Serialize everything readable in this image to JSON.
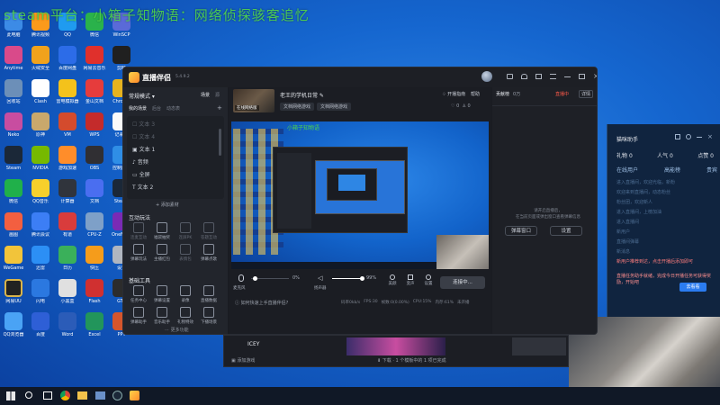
{
  "overlay": {
    "title": "steam平台：小箱子知物语：网络侦探骇客追忆"
  },
  "desktop_icons": [
    {
      "label": "此电脑",
      "color": "#3c8be6"
    },
    {
      "label": "腾讯视频",
      "color": "#fb9a1b"
    },
    {
      "label": "QQ",
      "color": "#1f9bf0"
    },
    {
      "label": "微信",
      "color": "#2ab24b"
    },
    {
      "label": "WinSCP",
      "color": "#5a6ad8"
    },
    {
      "label": "Anytime",
      "color": "#d94a8a"
    },
    {
      "label": "火绒安全",
      "color": "#f1a21c"
    },
    {
      "label": "百度网盘",
      "color": "#2c6ce8"
    },
    {
      "label": "网易云音乐",
      "color": "#e0302c"
    },
    {
      "label": "剪映",
      "color": "#202020"
    },
    {
      "label": "回收站",
      "color": "#6c8fb8"
    },
    {
      "label": "Clash",
      "color": "#ffffff"
    },
    {
      "label": "雷电模拟器",
      "color": "#f4c21b"
    },
    {
      "label": "金山文档",
      "color": "#e63c3c"
    },
    {
      "label": "Chrome",
      "color": "#e6b31f"
    },
    {
      "label": "Neko",
      "color": "#c84da0"
    },
    {
      "label": "原神",
      "color": "#c9a86c"
    },
    {
      "label": "VM",
      "color": "#d44b2d"
    },
    {
      "label": "WPS",
      "color": "#c42b2b"
    },
    {
      "label": "记事本",
      "color": "#fafafa"
    },
    {
      "label": "Steam",
      "color": "#1b2838"
    },
    {
      "label": "NVIDIA",
      "color": "#76b900"
    },
    {
      "label": "游戏加速",
      "color": "#ff8d2a"
    },
    {
      "label": "OBS",
      "color": "#302f33"
    },
    {
      "label": "控制面板",
      "color": "#2f8ee6"
    },
    {
      "label": "微信",
      "color": "#20b04a"
    },
    {
      "label": "QQ音乐",
      "color": "#f7d02b"
    },
    {
      "label": "计算器",
      "color": "#30343c"
    },
    {
      "label": "文档",
      "color": "#4a6ef0"
    },
    {
      "label": "Steam",
      "color": "#1b2838"
    },
    {
      "label": "画图",
      "color": "#f35f40"
    },
    {
      "label": "腾讯会议",
      "color": "#3c7ef5"
    },
    {
      "label": "有道",
      "color": "#d93c3c"
    },
    {
      "label": "CPU-Z",
      "color": "#7ea0c8"
    },
    {
      "label": "OneNote",
      "color": "#7a2ab5"
    },
    {
      "label": "WeGame",
      "color": "#f2c43a"
    },
    {
      "label": "迅雷",
      "color": "#2c8ff5"
    },
    {
      "label": "日历",
      "color": "#3ab05a"
    },
    {
      "label": "快压",
      "color": "#f59c1b"
    },
    {
      "label": "设置",
      "color": "#b0b6c0"
    },
    {
      "label": "网易UU",
      "color": "#222",
      "gold": true
    },
    {
      "label": "闪电",
      "color": "#2b78e0"
    },
    {
      "label": "小黑盒",
      "color": "#e0e0e0"
    },
    {
      "label": "Flash",
      "color": "#d03030"
    },
    {
      "label": "GTA",
      "color": "#2c2c2c"
    },
    {
      "label": "QQ浏览器",
      "color": "#4aa3f5"
    },
    {
      "label": "百度",
      "color": "#2e5fd6"
    },
    {
      "label": "Word",
      "color": "#2b5cb8"
    },
    {
      "label": "Excel",
      "color": "#22955b"
    },
    {
      "label": "PPT",
      "color": "#d5552c"
    }
  ],
  "app": {
    "logo": "直播伴侣",
    "version": "5.4.9.2",
    "streamer_name": "老王的学机日常",
    "thumb_label": "在线网络版",
    "tags": [
      "文档网络游戏",
      "文档网络游戏"
    ],
    "topbar": {
      "notice": "开播指南",
      "help": "帮助",
      "rank_label": "贡献榜",
      "rank_value": "0万",
      "live_label": "直播中",
      "extra": "详情"
    },
    "metrics": {
      "likes": "0",
      "viewers": "0"
    },
    "sidebar": {
      "mode_label": "常规模式",
      "tab_scenes": "场景",
      "tab_sources": "源",
      "sub_tabs": [
        "我的场景",
        "后台",
        "动态表"
      ],
      "scene_items": [
        "文本 3",
        "文本 4",
        "文本 1",
        "音频",
        "全屏",
        "文本 2"
      ],
      "add_material": "+ 添加素材",
      "interact_title": "互动玩法",
      "interact_items": [
        "连麦互动",
        "福袋抽奖",
        "连屏PK",
        "答题互动",
        "弹幕玩法",
        "主播红包",
        "表情包",
        "弹幕点歌"
      ],
      "tools_title": "基础工具",
      "tool_items": [
        "任务中心",
        "弹幕设置",
        "录像",
        "直播数据",
        "弹幕助手",
        "音乐助手",
        "礼物特效",
        "下播场景"
      ],
      "more": "更多功能"
    },
    "controls": {
      "mic_label": "麦克风",
      "mic_value": "0%",
      "speaker_label": "扬声器",
      "speaker_value": "99%",
      "beauty_label": "美颜",
      "effect_label": "变声",
      "settings_label": "设置",
      "start_button": "连接中..."
    },
    "ticker": "如何快速上手直播伴侣?",
    "stats": [
      "码率0kb/s",
      "FPS:30",
      "帧数:0(0.00%)",
      "CPU:15%",
      "内存:61%",
      "未开播"
    ],
    "bottom_tabs": [
      "添加游戏"
    ],
    "game_label": "ICEY",
    "bottom_hint": "下载 · 1 个模板中的 1 项已完成",
    "chat": {
      "empty_title": "请开启直播后，",
      "empty_text": "在当前页面或弹出窗口查看弹幕信息",
      "btn_left": "弹幕窗口",
      "btn_right": "设置"
    }
  },
  "preview": {
    "inner_title": "小箱子知物语"
  },
  "right_panel": {
    "title": "猫咪助手",
    "counts": [
      {
        "label": "礼物",
        "value": "0"
      },
      {
        "label": "人气",
        "value": "0"
      },
      {
        "label": "点赞",
        "value": "0"
      }
    ],
    "tabs": [
      "在线用户",
      "高能榜",
      "贵宾"
    ],
    "lines": [
      "进入直播间，欢迎光临，新粉",
      "欢迎来到直播间，动态粉丝",
      "粉丝团，欢迎新人",
      "进入直播间，上榜加油",
      "进入直播间",
      "新用户",
      "直播间弹幕",
      "新消息"
    ],
    "notice_red": "新用户推荐到达，点击开播后添加即可",
    "notice_line": "直播任务助手就绪，完成今日开播任务可获得奖励，开始吧",
    "go_button": "去看看"
  },
  "taskbar": {
    "icons": [
      "start",
      "search",
      "task-view",
      "chrome",
      "explorer",
      "store",
      "terminal",
      "steam",
      "douyin"
    ]
  }
}
